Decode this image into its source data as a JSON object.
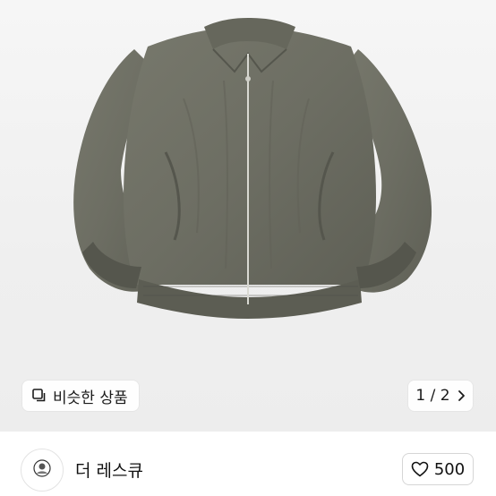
{
  "product_image": {
    "alt": "jacket-photo"
  },
  "similar": {
    "icon": "copy-squares-icon",
    "label": "비슷한 상품"
  },
  "pager": {
    "text": "1 / 2",
    "icon": "chevron-right-icon"
  },
  "seller": {
    "avatar_icon": "seller-avatar-icon",
    "name": "더 레스큐"
  },
  "like": {
    "icon": "heart-outline-icon",
    "count": "500"
  }
}
